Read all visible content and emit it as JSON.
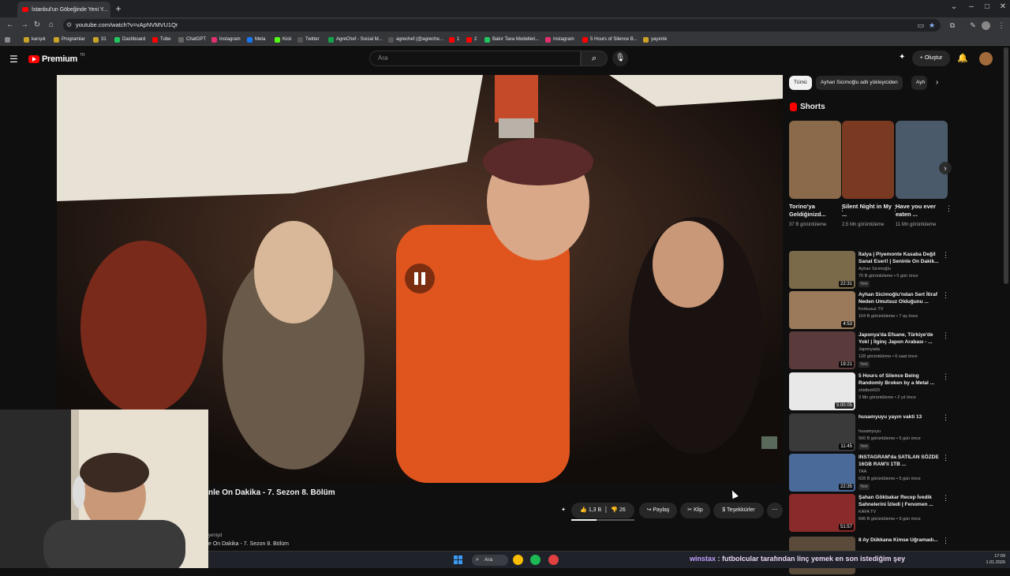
{
  "browser": {
    "tab_title": "İstanbul'un Göbeğinde Yeni Y...",
    "url": "youtube.com/watch?v=vApNVMVU1Qr",
    "bookmarks": [
      {
        "label": "karışık",
        "color": "#c9a227"
      },
      {
        "label": "Programlar",
        "color": "#c9a227"
      },
      {
        "label": "31",
        "color": "#c9a227"
      },
      {
        "label": "Dashboard",
        "color": "#22c55e"
      },
      {
        "label": "Tube",
        "color": "#ff0000"
      },
      {
        "label": "ChatGPT",
        "color": "#aaaaaa"
      },
      {
        "label": "Instagram",
        "color": "#e1306c"
      },
      {
        "label": "Meta",
        "color": "#1877f2"
      },
      {
        "label": "Kick",
        "color": "#53fc18"
      },
      {
        "label": "Twitter",
        "color": "#dddddd"
      },
      {
        "label": "AgreChef - Social M...",
        "color": "#16a34a"
      },
      {
        "label": "agrechef (@agreche...",
        "color": "#dddddd"
      },
      {
        "label": "1",
        "color": "#ff0000"
      },
      {
        "label": "2",
        "color": "#ff0000"
      },
      {
        "label": "Bakır Tava Modelleri...",
        "color": "#22c55e"
      },
      {
        "label": "Instagram",
        "color": "#e1306c"
      },
      {
        "label": "5 Hours of Silence B...",
        "color": "#ff0000"
      },
      {
        "label": "yayınlık",
        "color": "#c9a227"
      }
    ]
  },
  "header": {
    "logo_text": "Premium",
    "logo_region": "TR",
    "search_placeholder": "Ara",
    "create_label": "Oluştur"
  },
  "video": {
    "title_partial": "nle On Dakika - 7. Sezon 8. Bölüm",
    "channel_partial": "yeniyd",
    "desc_partial": "e On Dakika - 7. Sezon 8. Bölüm",
    "likes": "1,3 B",
    "like_ratio": 0.4,
    "comments": "26",
    "share_label": "Paylaş",
    "clip_label": "Klip",
    "thanks_label": "Teşekkürler"
  },
  "chips": [
    {
      "label": "Tümü",
      "active": true
    },
    {
      "label": "Ayhan Sicimoğlu adlı yükleyiciden",
      "active": false
    },
    {
      "label": "Ayh",
      "active": false
    }
  ],
  "shorts": {
    "heading": "Shorts",
    "items": [
      {
        "title": "Torino'ya Geldiğinizd...",
        "views": "37 B görüntüleme",
        "bg": "#8a6a4a"
      },
      {
        "title": "Silent Night in My ...",
        "views": "2,5 Mn görüntüleme",
        "bg": "#7a3a22"
      },
      {
        "title": "Have you ever eaten ...",
        "views": "11 Mn görüntüleme",
        "bg": "#4a5a6a"
      }
    ]
  },
  "recommended": [
    {
      "title": "İtalya | Piyemonte Kasaba Değil Sanat Eseri! | Seninle On Dakik...",
      "channel": "Ayhan Sicimoğlu",
      "verified": true,
      "meta": "70 B görüntüleme • 5 gün önce",
      "new": "Yeni",
      "duration": "22:31",
      "bg": "#7a6a4a"
    },
    {
      "title": "Ayhan Sicimoğlu'ndan Sert İtiraf Neden Umutsuz Olduğunu ...",
      "channel": "Korkusuz TV",
      "verified": false,
      "meta": "104 B görüntüleme • 7 ay önce",
      "new": "",
      "duration": "4:53",
      "bg": "#9a7a5a"
    },
    {
      "title": "Japonya'da Efsane, Türkiye'de Yok! | İlginç Japon Arabası - ...",
      "channel": "Japonyada",
      "verified": false,
      "meta": "128 görüntüleme • 6 saat önce",
      "new": "Yeni",
      "duration": "19:21",
      "bg": "#5a3a3a"
    },
    {
      "title": "5 Hours of Silence Being Randomly Broken by a Metal ...",
      "channel": "shidbot420",
      "verified": true,
      "meta": "3 Mn görüntüleme • 2 yıl önce",
      "new": "",
      "duration": "5:00:05",
      "bg": "#e8e8e8"
    },
    {
      "title": "husamyuyu yayın vakti 13",
      "channel": "husamyuyu",
      "verified": false,
      "meta": "560 B görüntüleme • 5 gün önce",
      "new": "Yeni",
      "duration": "11:45",
      "bg": "#3a3a3a"
    },
    {
      "title": "INSTAGRAM'da SATILAN SÖZDE 16GB RAM'li 1TB ...",
      "channel": "TAA",
      "verified": true,
      "meta": "628 B görüntüleme • 5 gün önce",
      "new": "Yeni",
      "duration": "22:35",
      "bg": "#4a6a9a"
    },
    {
      "title": "Şahan Gökbakar Recep İvedik Sahnelerini İzledi | Fenomen ...",
      "channel": "KAFA TV",
      "verified": true,
      "meta": "696 B görüntüleme • 9 gün önce",
      "new": "",
      "duration": "51:57",
      "bg": "#8a2a2a"
    },
    {
      "title": "8 Ay Dükkana Kimse Uğramadı...",
      "channel": "",
      "verified": false,
      "meta": "",
      "new": "",
      "duration": "",
      "bg": "#5a4a3a"
    }
  ],
  "taskbar": {
    "search_label": "Ara",
    "ticker": "futbolcular tarafından linç yemek en son istediğim şey",
    "ticker_user": "winstax",
    "time": "17:09",
    "date": "1.01.2026"
  }
}
